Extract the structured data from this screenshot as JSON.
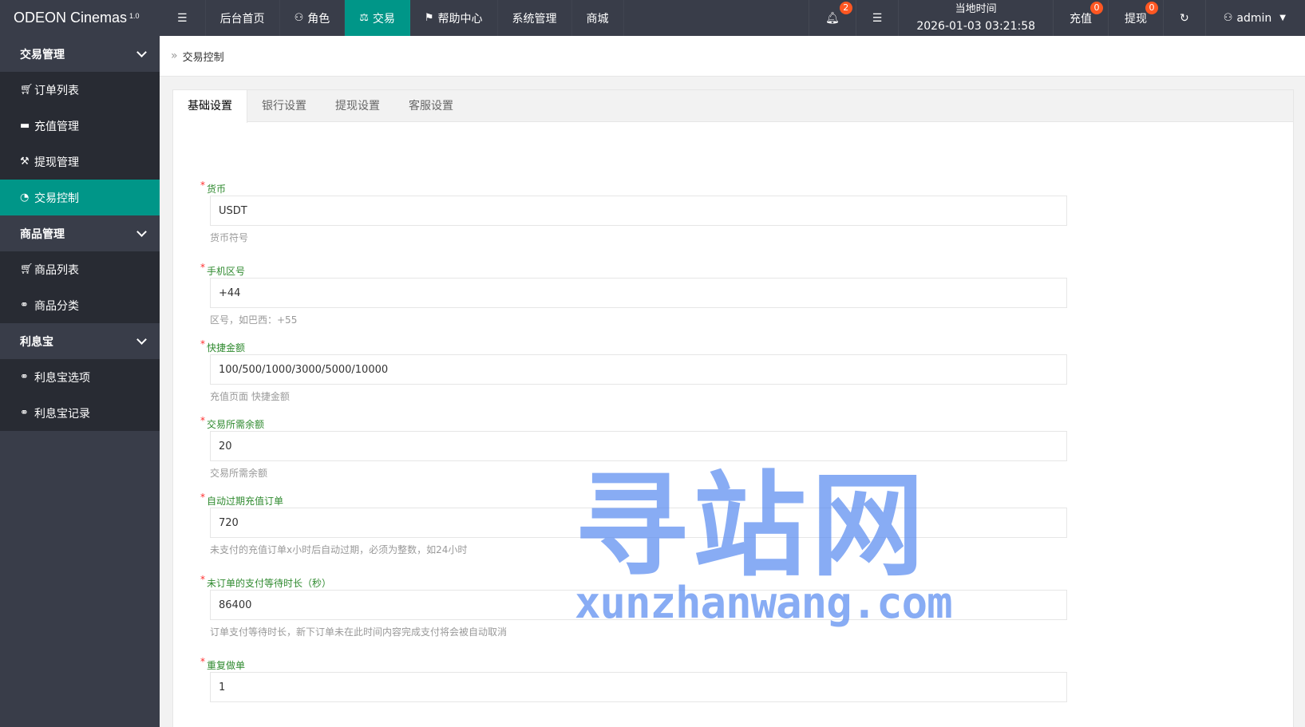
{
  "header": {
    "brand": "ODEON Cinemas",
    "version": "1.0",
    "menu_toggle_icon": "menu-icon",
    "nav": [
      {
        "label": "后台首页",
        "icon": ""
      },
      {
        "label": "角色",
        "icon": "user-icon"
      },
      {
        "label": "交易",
        "icon": "balance-icon"
      },
      {
        "label": "帮助中心",
        "icon": "flag-icon"
      },
      {
        "label": "系统管理",
        "icon": ""
      },
      {
        "label": "商城",
        "icon": ""
      }
    ],
    "notification_count": "2",
    "time_label": "当地时间",
    "time_value": "2026-01-03 03:21:58",
    "recharge_label": "充值",
    "recharge_count": "0",
    "withdraw_label": "提现",
    "withdraw_count": "0",
    "user_label": "admin"
  },
  "sidebar": {
    "groups": [
      {
        "label": "交易管理",
        "items": [
          "订单列表",
          "充值管理",
          "提现管理",
          "交易控制"
        ]
      },
      {
        "label": "商品管理",
        "items": [
          "商品列表",
          "商品分类"
        ]
      },
      {
        "label": "利息宝",
        "items": [
          "利息宝选项",
          "利息宝记录"
        ]
      }
    ],
    "active_item": "交易控制"
  },
  "breadcrumb": {
    "current": "交易控制"
  },
  "tabs": [
    "基础设置",
    "银行设置",
    "提现设置",
    "客服设置"
  ],
  "form": {
    "fields": [
      {
        "label": "货币",
        "value": "USDT",
        "help": "货币符号"
      },
      {
        "label": "手机区号",
        "value": "+44",
        "help": "区号，如巴西：+55"
      },
      {
        "label": "快捷金额",
        "value": "100/500/1000/3000/5000/10000",
        "help": "充值页面 快捷金额"
      },
      {
        "label": "交易所需余额",
        "value": "20",
        "help": "交易所需余额"
      },
      {
        "label": "自动过期充值订单",
        "value": "720",
        "help": "未支付的充值订单x小时后自动过期，必须为整数，如24小时"
      },
      {
        "label": "未订单的支付等待时长（秒）",
        "value": "86400",
        "help": "订单支付等待时长，新下订单未在此时间内容完成支付将会被自动取消"
      },
      {
        "label": "重复做单",
        "value": "1",
        "help": ""
      }
    ]
  },
  "watermark": {
    "main": "寻站网",
    "sub": "xunzhanwang.com"
  },
  "colors": {
    "header_bg": "#393d49",
    "accent": "#009688",
    "badge": "#ff5722",
    "label": "#2f8a2f"
  }
}
